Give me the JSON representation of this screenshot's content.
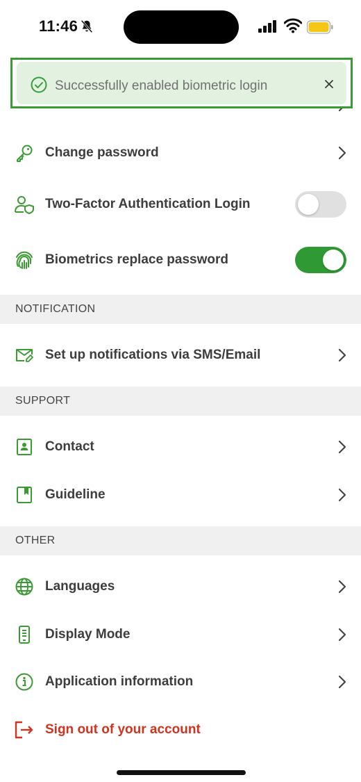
{
  "status_bar": {
    "time": "11:46"
  },
  "toast": {
    "message": "Successfully enabled biometric login",
    "icon": "check-circle-icon"
  },
  "security": {
    "items": [
      {
        "label": "Change password",
        "icon": "key-icon"
      },
      {
        "label": "Two-Factor Authentication Login",
        "icon": "user-shield-icon",
        "toggle": false
      },
      {
        "label": "Biometrics replace password",
        "icon": "fingerprint-icon",
        "toggle": true
      }
    ]
  },
  "notification": {
    "header": "NOTIFICATION",
    "items": [
      {
        "label": "Set up notifications via SMS/Email",
        "icon": "mail-edit-icon"
      }
    ]
  },
  "support": {
    "header": "SUPPORT",
    "items": [
      {
        "label": "Contact",
        "icon": "contact-card-icon"
      },
      {
        "label": "Guideline",
        "icon": "book-icon"
      }
    ]
  },
  "other": {
    "header": "OTHER",
    "items": [
      {
        "label": "Languages",
        "icon": "globe-icon"
      },
      {
        "label": "Display Mode",
        "icon": "phone-display-icon"
      },
      {
        "label": "Application information",
        "icon": "info-icon"
      }
    ]
  },
  "sign_out": {
    "label": "Sign out of your account",
    "icon": "logout-icon"
  },
  "colors": {
    "accent": "#2f9a34",
    "danger": "#d0341f",
    "section_bg": "#f0f0f0",
    "toast_bg": "#e3f2e0"
  }
}
